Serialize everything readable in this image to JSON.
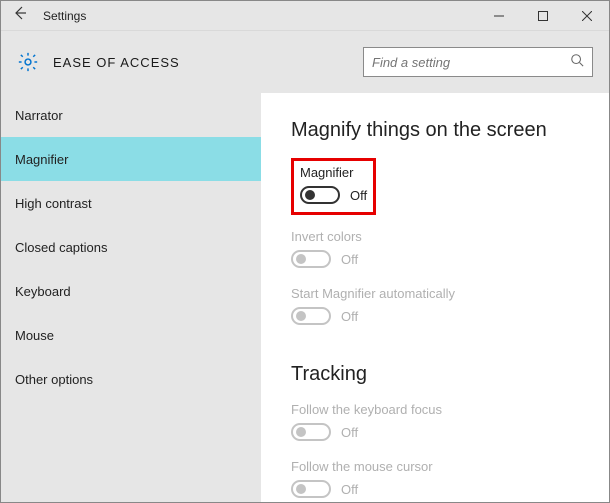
{
  "titlebar": {
    "title": "Settings"
  },
  "header": {
    "title": "EASE OF ACCESS",
    "search_placeholder": "Find a setting"
  },
  "sidebar": {
    "items": [
      {
        "label": "Narrator"
      },
      {
        "label": "Magnifier",
        "selected": true
      },
      {
        "label": "High contrast"
      },
      {
        "label": "Closed captions"
      },
      {
        "label": "Keyboard"
      },
      {
        "label": "Mouse"
      },
      {
        "label": "Other options"
      }
    ]
  },
  "content": {
    "section1_title": "Magnify things on the screen",
    "settings1": [
      {
        "label": "Magnifier",
        "state": "Off",
        "disabled": false,
        "highlight": true
      },
      {
        "label": "Invert colors",
        "state": "Off",
        "disabled": true
      },
      {
        "label": "Start Magnifier automatically",
        "state": "Off",
        "disabled": true
      }
    ],
    "section2_title": "Tracking",
    "settings2": [
      {
        "label": "Follow the keyboard focus",
        "state": "Off",
        "disabled": true
      },
      {
        "label": "Follow the mouse cursor",
        "state": "Off",
        "disabled": true
      }
    ]
  }
}
